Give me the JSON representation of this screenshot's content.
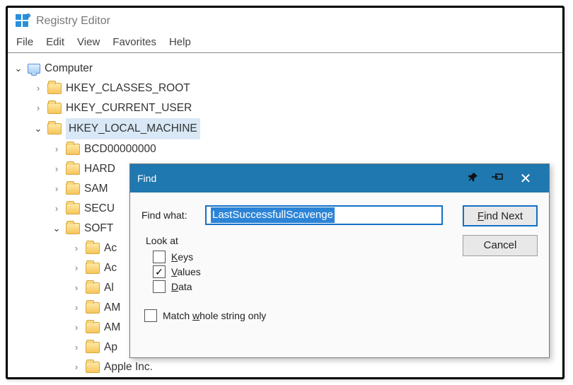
{
  "window": {
    "title": "Registry Editor"
  },
  "menubar": [
    "File",
    "Edit",
    "View",
    "Favorites",
    "Help"
  ],
  "tree": {
    "root": "Computer",
    "hives": [
      {
        "name": "HKEY_CLASSES_ROOT",
        "expanded": false
      },
      {
        "name": "HKEY_CURRENT_USER",
        "expanded": false
      },
      {
        "name": "HKEY_LOCAL_MACHINE",
        "expanded": true,
        "selected": true,
        "children": [
          {
            "name": "BCD00000000",
            "expanded": false
          },
          {
            "name": "HARD",
            "expanded": false
          },
          {
            "name": "SAM",
            "expanded": false
          },
          {
            "name": "SECU",
            "expanded": false
          },
          {
            "name": "SOFT",
            "expanded": true,
            "children": [
              {
                "name": "Ac"
              },
              {
                "name": "Ac"
              },
              {
                "name": "Al"
              },
              {
                "name": "AM"
              },
              {
                "name": "AM"
              },
              {
                "name": "Ap"
              },
              {
                "name": "Apple Inc."
              }
            ]
          }
        ]
      }
    ]
  },
  "find": {
    "title": "Find",
    "label_findwhat": "Find what:",
    "input_value": "LastSuccessfullScavenge",
    "button_findnext": "Find Next",
    "button_cancel": "Cancel",
    "group_label": "Look at",
    "chk_keys": {
      "label": "Keys",
      "checked": false
    },
    "chk_values": {
      "label": "Values",
      "checked": true
    },
    "chk_data": {
      "label": "Data",
      "checked": false
    },
    "chk_match": {
      "label": "Match whole string only",
      "checked": false
    }
  }
}
